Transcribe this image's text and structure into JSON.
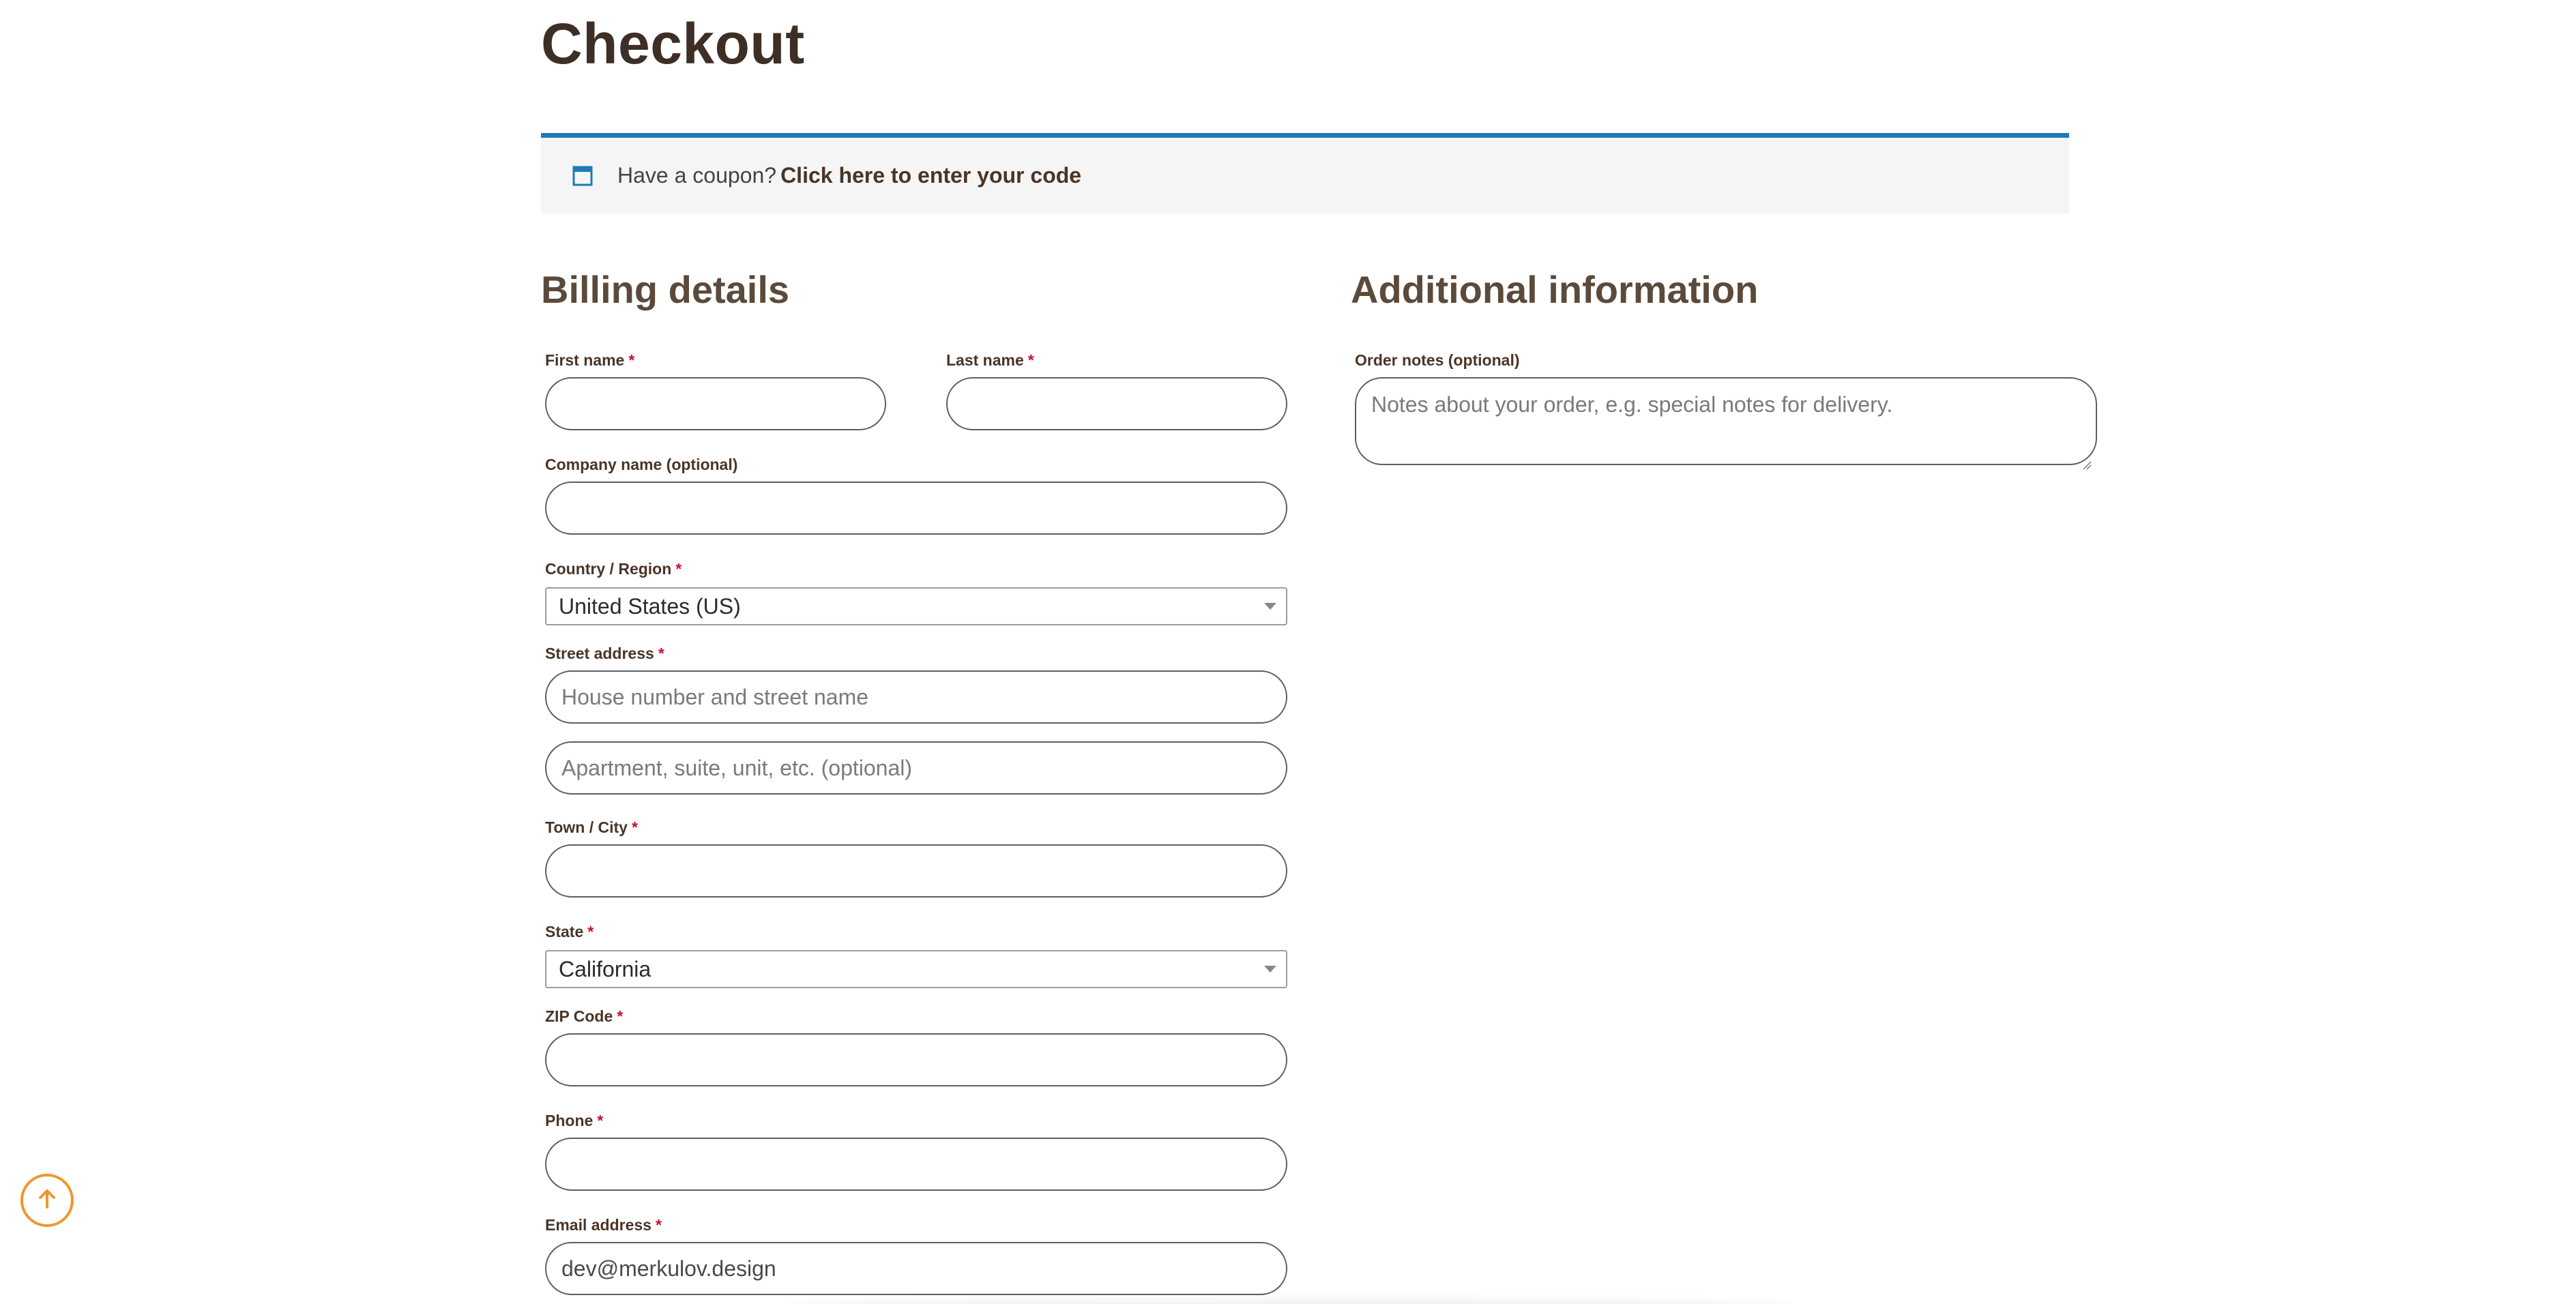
{
  "page": {
    "title": "Checkout"
  },
  "coupon": {
    "icon": "calendar-window-icon",
    "text": "Have a coupon?",
    "link": "Click here to enter your code"
  },
  "billing": {
    "title": "Billing details",
    "first_name": {
      "label": "First name",
      "required": "*",
      "value": ""
    },
    "last_name": {
      "label": "Last name",
      "required": "*",
      "value": ""
    },
    "company": {
      "label": "Company name (optional)",
      "value": ""
    },
    "country": {
      "label": "Country / Region",
      "required": "*",
      "value": "United States (US)"
    },
    "street": {
      "label": "Street address",
      "required": "*",
      "line1_placeholder": "House number and street name",
      "line2_placeholder": "Apartment, suite, unit, etc. (optional)"
    },
    "city": {
      "label": "Town / City",
      "required": "*",
      "value": ""
    },
    "state": {
      "label": "State",
      "required": "*",
      "value": "California"
    },
    "zip": {
      "label": "ZIP Code",
      "required": "*",
      "value": ""
    },
    "phone": {
      "label": "Phone",
      "required": "*",
      "value": ""
    },
    "email": {
      "label": "Email address",
      "required": "*",
      "value": "dev@merkulov.design"
    }
  },
  "additional": {
    "title": "Additional information",
    "order_notes": {
      "label": "Order notes (optional)",
      "placeholder": "Notes about your order, e.g. special notes for delivery."
    }
  },
  "scroll_top": {
    "icon": "arrow-up-icon"
  },
  "colors": {
    "accent_blue": "#1e7ab8",
    "heading_brown": "#3d2f25",
    "section_brown": "#5b4a3a",
    "required_red": "#c8102e",
    "scroll_orange": "#f0962e",
    "coupon_bg": "#f5f5f5"
  }
}
